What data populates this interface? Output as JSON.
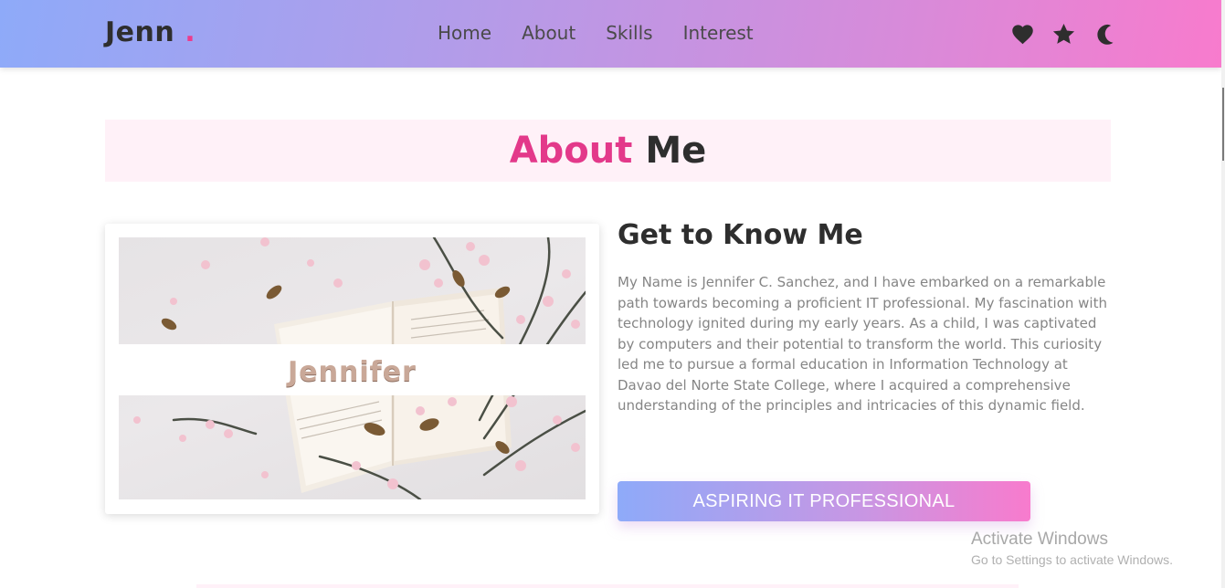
{
  "nav": {
    "logo_text": "Jenn",
    "logo_dot": ".",
    "links": [
      "Home",
      "About",
      "Skills",
      "Interest"
    ],
    "icons": [
      "heart-icon",
      "star-icon",
      "moon-icon"
    ]
  },
  "about": {
    "title_accent": "About",
    "title_rest": "Me",
    "photo_caption": "Jennifer",
    "heading": "Get to Know Me",
    "paragraph": "My Name is Jennifer C. Sanchez, and I have embarked on a remarkable path towards becoming a proficient IT professional. My fascination with technology ignited during my early years. As a child, I was captivated by computers and their potential to transform the world. This curiosity led me to pursue a formal education in Information Technology at Davao del Norte State College, where I acquired a comprehensive understanding of the principles and intricacies of this dynamic field.",
    "cta_label": "ASPIRING IT PROFESSIONAL"
  },
  "watermark": {
    "title": "Activate Windows",
    "subtitle": "Go to Settings to activate Windows."
  },
  "colors": {
    "accent_pink": "#e3398a",
    "gradient_start": "#8eaaf9",
    "gradient_end": "#f87bcd",
    "title_background": "#fff1f8"
  }
}
